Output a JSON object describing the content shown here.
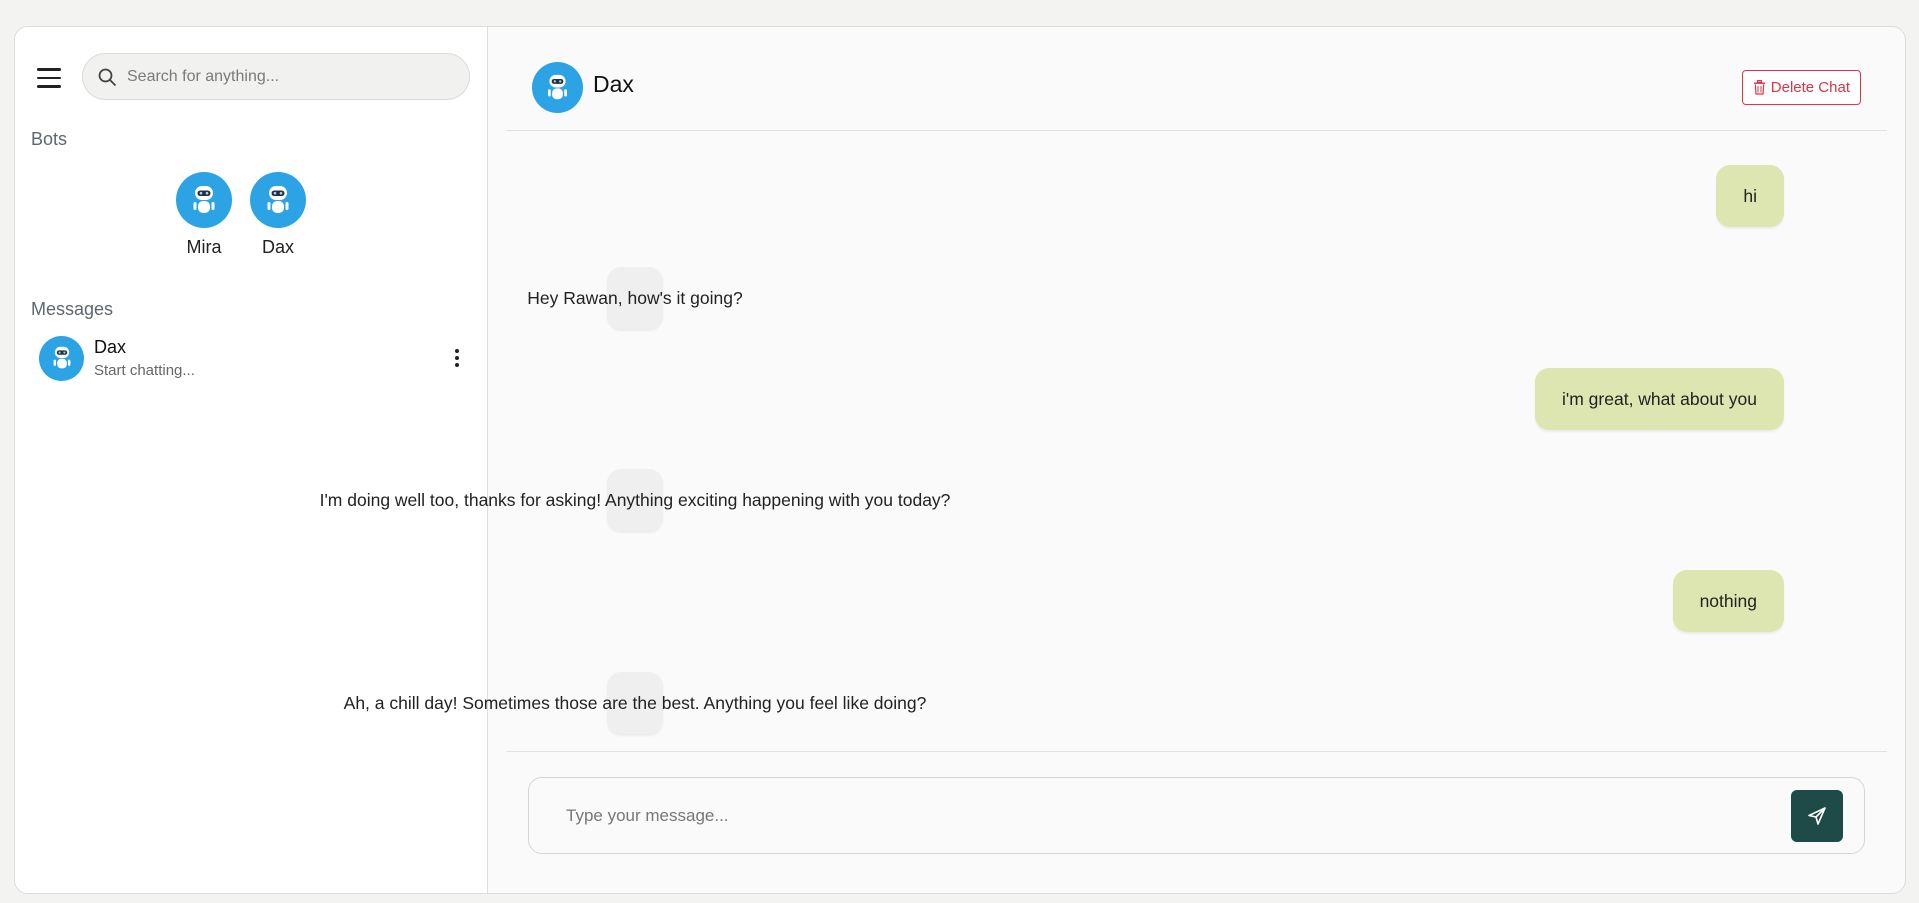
{
  "search": {
    "placeholder": "Search for anything..."
  },
  "sidebar": {
    "bots_title": "Bots",
    "bots": [
      {
        "name": "Mira",
        "icon": "robot-icon"
      },
      {
        "name": "Dax",
        "icon": "robot-icon"
      }
    ],
    "messages_title": "Messages",
    "conversations": [
      {
        "name": "Dax",
        "preview": "Start chatting..."
      }
    ]
  },
  "chat": {
    "title": "Dax",
    "delete_label": "Delete Chat",
    "messages": [
      {
        "from": "user",
        "text": "hi"
      },
      {
        "from": "bot",
        "text": "Hey Rawan, how's it going?"
      },
      {
        "from": "user",
        "text": "i'm great, what about you"
      },
      {
        "from": "bot",
        "text": "I'm doing well too, thanks for asking! Anything exciting happening with you today?"
      },
      {
        "from": "user",
        "text": "nothing"
      },
      {
        "from": "bot",
        "text": "Ah, a chill day! Sometimes those are the best. Anything you feel like doing?"
      }
    ],
    "input_placeholder": "Type your message..."
  },
  "colors": {
    "avatar_blue": "#2ba3e4",
    "user_bubble": "#dde6b0",
    "bot_bubble": "#efefef",
    "send_button": "#1e4a47",
    "delete_red": "#dc3545"
  }
}
